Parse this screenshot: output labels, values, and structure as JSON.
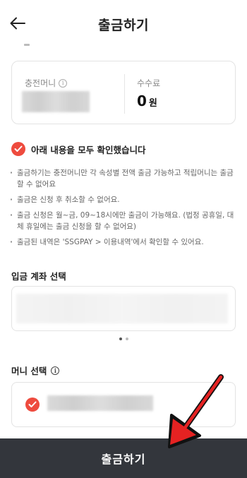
{
  "header": {
    "title": "출금하기",
    "back_icon": "arrow-left-icon"
  },
  "balance": {
    "charge_money_label": "충전머니",
    "fee_label": "수수료",
    "fee_value": "0",
    "fee_unit": "원"
  },
  "confirm": {
    "label": "아래 내용을 모두 확인했습니다",
    "checked": true
  },
  "notes": [
    "출금하기는 충전머니만 각 속성별 전액 출금 가능하고 적립머니는 출금할 수 없어요",
    "출금은 신청 후 취소할 수 없어요.",
    "출금 신청은 월~금, 09~18시에만 출금이 가능해요. (법정 공휴일, 대체 휴일에는 출금 신청을 할 수 없어요)",
    "출금된 내역은 'SSGPAY > 이용내역'에서 확인할 수 있어요."
  ],
  "account_section": {
    "title": "입금 계좌 선택",
    "page_indicator": {
      "total": 2,
      "active": 1
    }
  },
  "money_section": {
    "title": "머니 선택",
    "selected": true
  },
  "submit": {
    "label": "출금하기"
  },
  "colors": {
    "accent": "#ee4b3e",
    "button_bg": "#33363c",
    "annotation_arrow": "#e52222"
  }
}
